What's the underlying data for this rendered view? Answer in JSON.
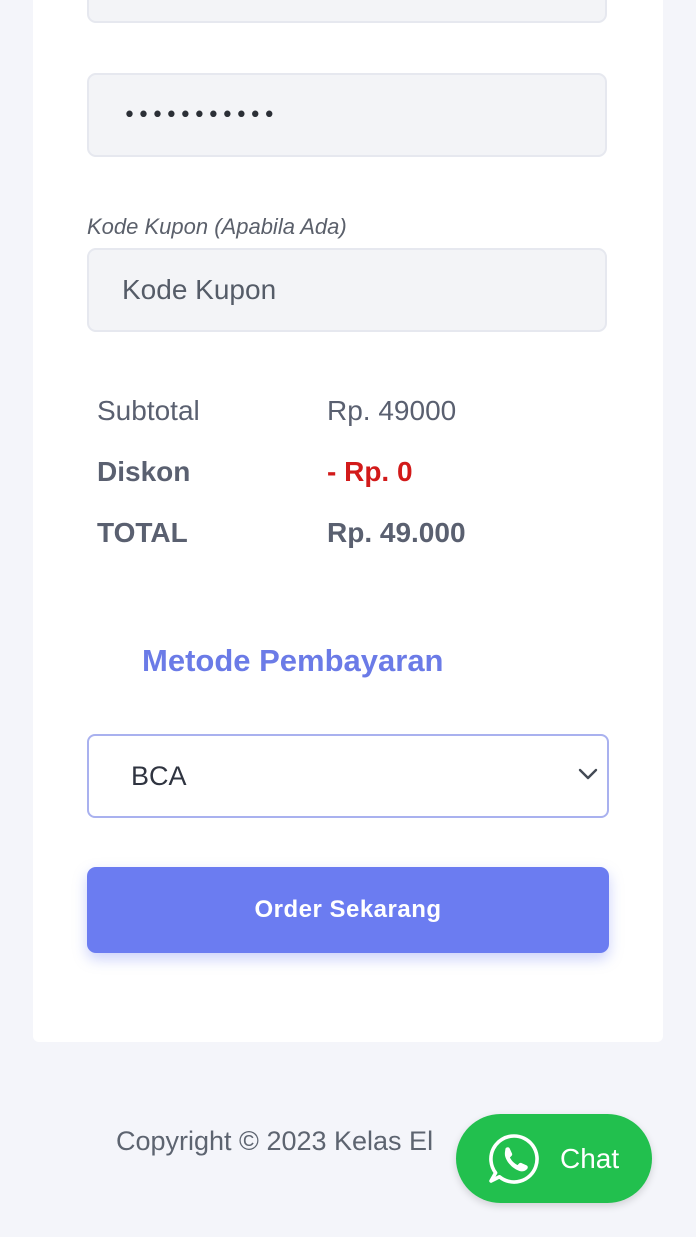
{
  "form": {
    "password_mask": "•••••••••••",
    "coupon": {
      "label": "Kode Kupon (Apabila Ada)",
      "placeholder": "Kode Kupon",
      "value": ""
    }
  },
  "summary": {
    "subtotal_label": "Subtotal",
    "subtotal_value": "Rp. 49000",
    "discount_label": "Diskon",
    "discount_value": "- Rp. 0",
    "total_label": "TOTAL",
    "total_value": "Rp. 49.000"
  },
  "payment": {
    "title": "Metode Pembayaran",
    "selected": "BCA"
  },
  "order_button": "Order Sekarang",
  "footer": {
    "copyright": "Copyright © 2023 Kelas El"
  },
  "chat": {
    "label": "Chat",
    "icon": "whatsapp-icon"
  },
  "colors": {
    "accent": "#6b7cf1",
    "discount": "#d21a1a",
    "chat": "#22c04e"
  }
}
